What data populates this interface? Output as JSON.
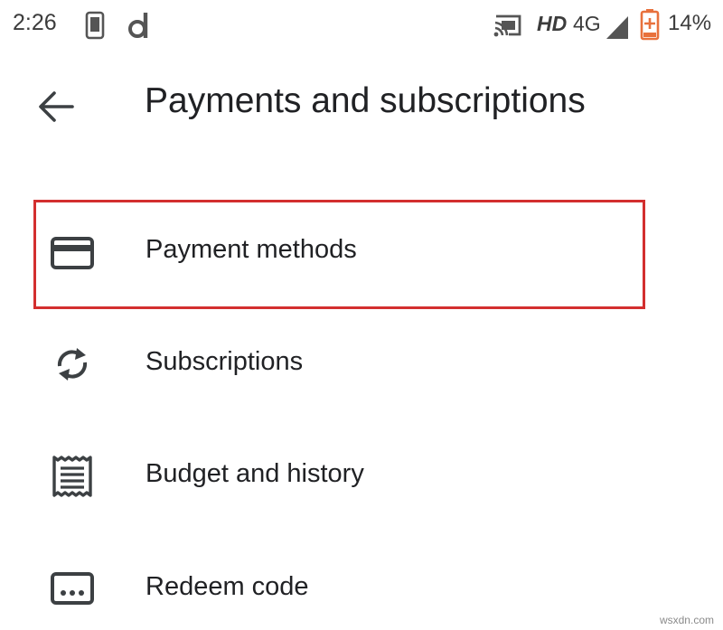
{
  "status_bar": {
    "time": "2:26",
    "network_badge": "HD",
    "network_type": "4G",
    "battery_percent": "14%",
    "icons": [
      "phone-notification-icon",
      "d-app-icon",
      "cast-icon",
      "signal-icon",
      "battery-charging-icon"
    ]
  },
  "header": {
    "back_icon": "arrow-back-icon",
    "title": "Payments and subscriptions"
  },
  "menu": {
    "items": [
      {
        "label": "Payment methods",
        "icon": "credit-card-icon",
        "highlighted": true
      },
      {
        "label": "Subscriptions",
        "icon": "sync-icon"
      },
      {
        "label": "Budget and history",
        "icon": "receipt-icon"
      },
      {
        "label": "Redeem code",
        "icon": "redeem-code-icon"
      }
    ]
  },
  "colors": {
    "highlight": "#d32f2f",
    "icon": "#3c4043",
    "text": "#202124",
    "battery": "#e8713d"
  },
  "watermark": "wsxdn.com"
}
